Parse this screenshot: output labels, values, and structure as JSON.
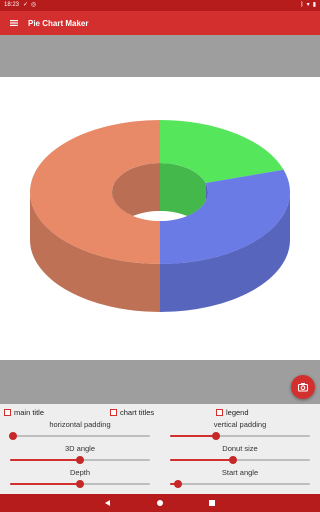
{
  "status_bar": {
    "time": "18:23",
    "left_icons": [
      "signal-check-icon",
      "data-saver-icon"
    ],
    "right_icons": [
      "bluetooth-icon",
      "wifi-icon",
      "battery-icon"
    ]
  },
  "app_bar": {
    "title": "Pie Chart Maker",
    "menu_icon": "hamburger-menu-icon"
  },
  "chart_data": {
    "type": "pie",
    "style": "3d-donut",
    "slices": [
      {
        "value": 20,
        "color": "#55e65c"
      },
      {
        "value": 30,
        "color": "#6b7be6"
      },
      {
        "value": 50,
        "color": "#e88a68"
      }
    ],
    "title": "",
    "legend": false
  },
  "fab": {
    "icon": "camera-icon"
  },
  "checkboxes": [
    {
      "label": "main title",
      "checked": false
    },
    {
      "label": "chart titles",
      "checked": false
    },
    {
      "label": "legend",
      "checked": false
    }
  ],
  "sliders": [
    {
      "label": "horizontal padding",
      "value": 0.02
    },
    {
      "label": "vertical padding",
      "value": 0.33
    },
    {
      "label": "3D angle",
      "value": 0.5
    },
    {
      "label": "Donut size",
      "value": 0.45
    },
    {
      "label": "Depth",
      "value": 0.5
    },
    {
      "label": "Start angle",
      "value": 0.06
    }
  ],
  "nav": {
    "back_icon": "back-icon",
    "home_icon": "home-icon",
    "recents_icon": "recents-icon"
  },
  "colors": {
    "primary": "#d32f2f",
    "primary_dark": "#b71c1c",
    "panel_gray": "#9e9e9e"
  }
}
